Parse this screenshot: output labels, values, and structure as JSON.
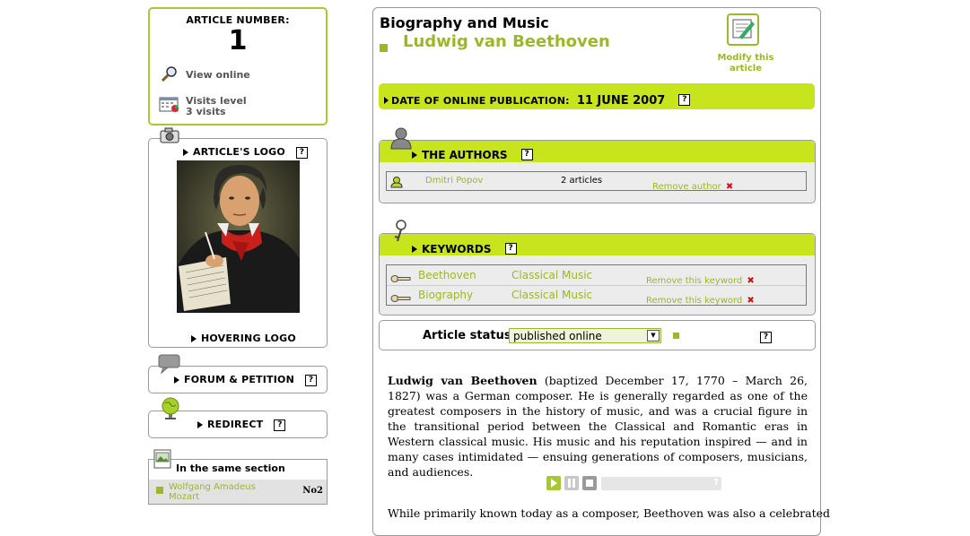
{
  "sidebar": {
    "article_box": {
      "number_label": "ARTICLE NUMBER:",
      "number": "1",
      "view_online": "View online",
      "visits_level": "Visits level",
      "visits_count": "3 visits"
    },
    "logo_box": {
      "title": "ARTICLE'S LOGO",
      "hover_title": "HOVERING LOGO"
    },
    "forum": {
      "title": "FORUM & PETITION"
    },
    "redirect": {
      "title": "REDIRECT"
    },
    "same_section": {
      "title": "In the same section",
      "item_title": "Wolfgang Amadeus Mozart",
      "item_number": "No2"
    },
    "help_glyph": "?"
  },
  "main": {
    "section": "Biography and Music",
    "title": "Ludwig van Beethoven",
    "modify_label": "Modify this article",
    "publication": {
      "label": "DATE OF ONLINE PUBLICATION:",
      "date": "11 JUNE 2007"
    },
    "authors": {
      "title": "THE AUTHORS",
      "rows": [
        {
          "name": "Dmitri Popov",
          "count": "2 articles",
          "remove": "Remove author"
        }
      ]
    },
    "keywords": {
      "title": "KEYWORDS",
      "rows": [
        {
          "keyword": "Beethoven",
          "group": "Classical Music",
          "remove": "Remove this keyword"
        },
        {
          "keyword": "Biography",
          "group": "Classical Music",
          "remove": "Remove this keyword"
        }
      ]
    },
    "status": {
      "label": "Article status:",
      "value": "published online"
    },
    "body": {
      "p1_bold": "Ludwig van Beethoven",
      "p1_rest": " (baptized December 17, 1770 – March 26, 1827) was a German composer. He is generally regarded as one of the greatest composers in the history of music, and was a crucial figure in the transitional period between the Classical and Romantic eras in Western classical music. His music and his reputation inspired — and in many cases intimidated — ensuing generations of composers, musicians, and audiences.",
      "p2": "While primarily known today as a composer, Beethoven was also a celebrated"
    },
    "player": {
      "help": "?"
    }
  },
  "colors": {
    "accent_green": "#c8e41c",
    "text_green": "#9ab82a",
    "border": "#9a9a9a",
    "remove_red": "#d21010"
  }
}
